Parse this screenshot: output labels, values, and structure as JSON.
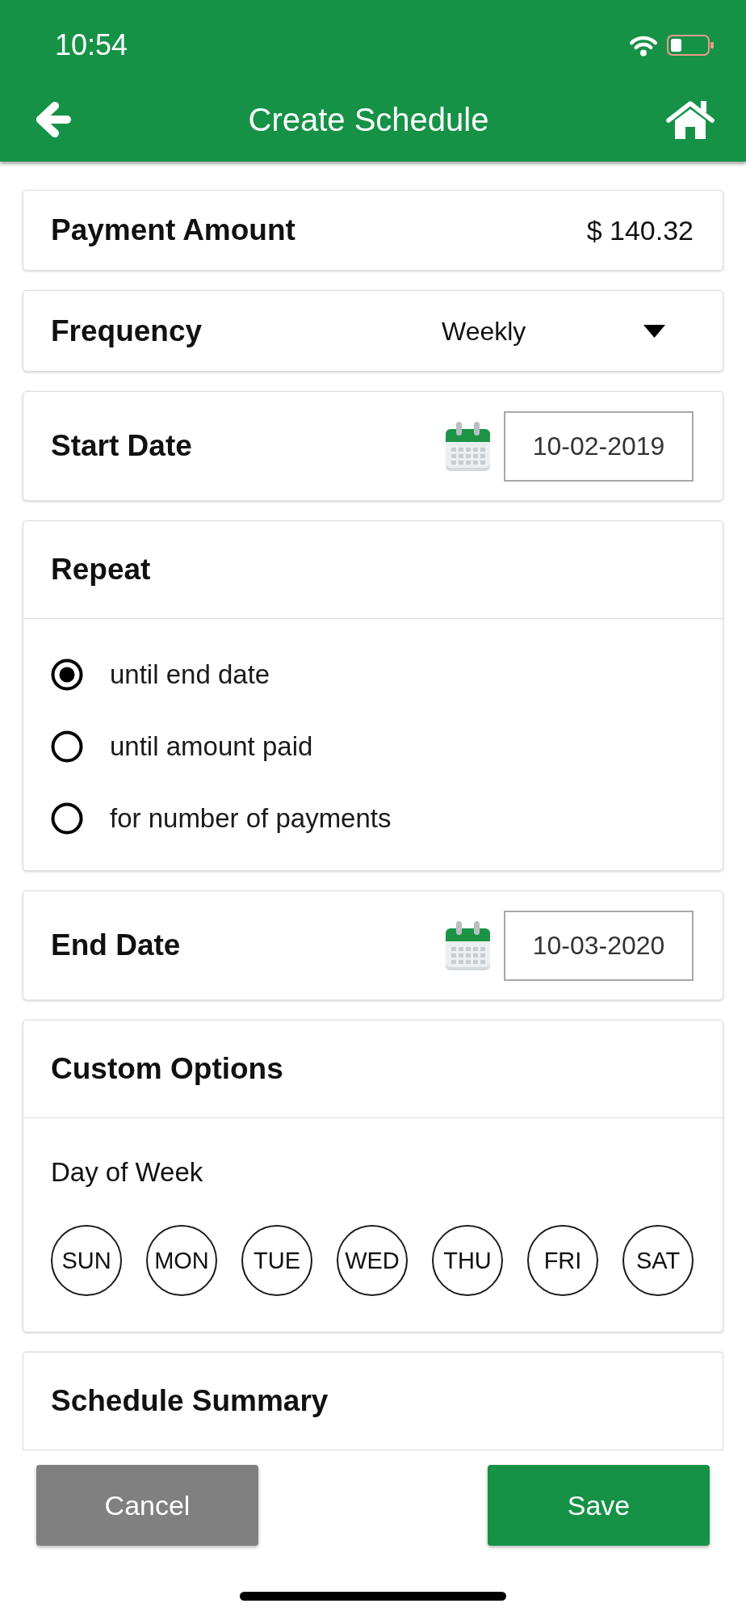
{
  "status_bar": {
    "time": "10:54"
  },
  "header": {
    "title": "Create Schedule"
  },
  "cards": [
    {
      "kind": "value",
      "label": "Payment Amount",
      "value": "$ 140.32"
    },
    {
      "kind": "dropdown",
      "label": "Frequency",
      "value": "Weekly"
    },
    {
      "kind": "date",
      "label": "Start Date",
      "value": "10-02-2019"
    },
    {
      "kind": "radio_group",
      "title": "Repeat",
      "options": [
        {
          "label": "until end date",
          "selected": true
        },
        {
          "label": "until amount paid",
          "selected": false
        },
        {
          "label": "for number of payments",
          "selected": false
        }
      ]
    },
    {
      "kind": "date",
      "label": "End Date",
      "value": "10-03-2020"
    },
    {
      "kind": "day_picker",
      "title": "Custom Options",
      "label": "Day of Week",
      "days": [
        {
          "label": "SUN",
          "selected": false
        },
        {
          "label": "MON",
          "selected": false
        },
        {
          "label": "TUE",
          "selected": false
        },
        {
          "label": "WED",
          "selected": false
        },
        {
          "label": "THU",
          "selected": false
        },
        {
          "label": "FRI",
          "selected": false
        },
        {
          "label": "SAT",
          "selected": false
        }
      ]
    },
    {
      "kind": "section",
      "title": "Schedule Summary"
    }
  ],
  "buttons": [
    {
      "kind": "cancel",
      "label": "Cancel"
    },
    {
      "kind": "save",
      "label": "Save"
    }
  ]
}
